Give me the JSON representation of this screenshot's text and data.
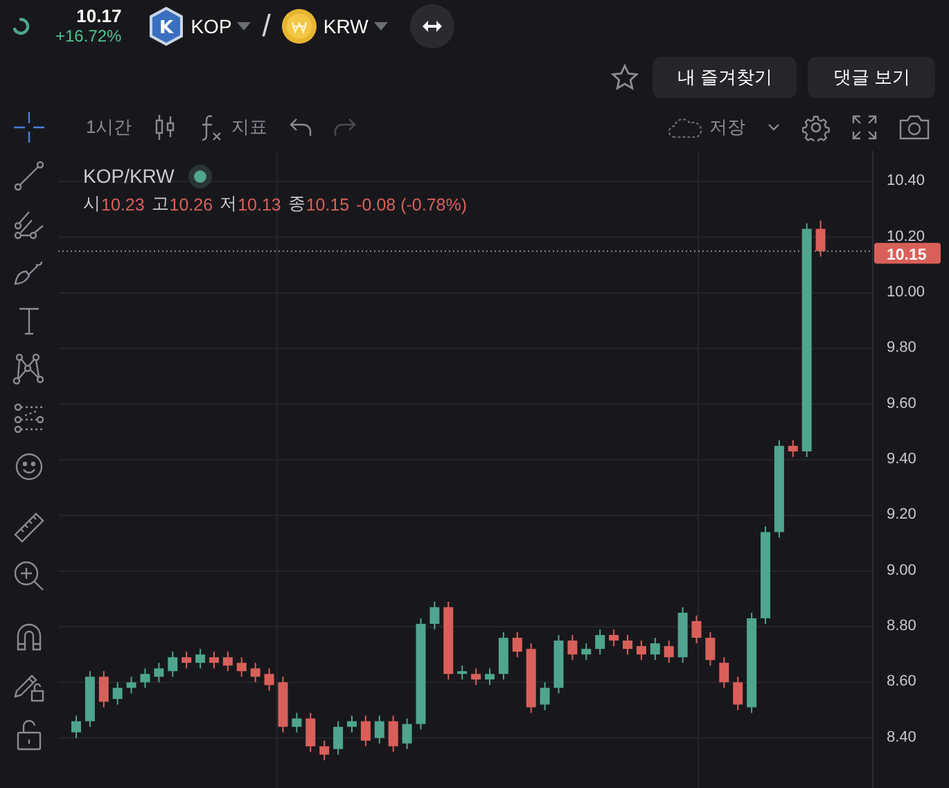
{
  "ticker": {
    "price": "10.17",
    "change": "+16.72%"
  },
  "pair": {
    "base": "KOP",
    "base_logo": "K",
    "separator": "/",
    "quote": "KRW"
  },
  "header_buttons": [
    {
      "label": "내 즐겨찾기"
    },
    {
      "label": "댓글 보기"
    }
  ],
  "chart_toolbar": {
    "interval": "1시간",
    "indicators": "지표",
    "save": "저장"
  },
  "tools": [
    {
      "kind": "crosshair",
      "selected": true
    },
    {
      "kind": "trendline",
      "selected": false
    },
    {
      "kind": "pitchfork",
      "selected": false
    },
    {
      "kind": "brush",
      "selected": false
    },
    {
      "kind": "text",
      "selected": false
    },
    {
      "kind": "pattern",
      "selected": false
    },
    {
      "kind": "prediction",
      "selected": false
    },
    {
      "kind": "emoji",
      "selected": false
    },
    {
      "kind": "ruler",
      "selected": false
    },
    {
      "kind": "zoom",
      "selected": false
    },
    {
      "kind": "magnet",
      "selected": false
    },
    {
      "kind": "lockdraw",
      "selected": false
    },
    {
      "kind": "lock",
      "selected": false
    }
  ],
  "legend": {
    "symbol": "KOP/KRW",
    "ohlc": [
      {
        "label": "시",
        "value": "10.23"
      },
      {
        "label": "고",
        "value": "10.26"
      },
      {
        "label": "저",
        "value": "10.13"
      },
      {
        "label": "종",
        "value": "10.15"
      }
    ],
    "change": "-0.08 (-0.78%)"
  },
  "chart": {
    "chart_data": {
      "type": "candlestick",
      "grid": true,
      "ylim": [
        8.22,
        10.51
      ],
      "ref_lines": [
        {
          "axis": "y",
          "value": 10.15
        }
      ],
      "ohlc": [
        [
          8.42,
          8.48,
          8.4,
          8.46
        ],
        [
          8.46,
          8.64,
          8.44,
          8.62
        ],
        [
          8.62,
          8.64,
          8.51,
          8.53
        ],
        [
          8.54,
          8.6,
          8.52,
          8.58
        ],
        [
          8.58,
          8.62,
          8.56,
          8.6
        ],
        [
          8.6,
          8.65,
          8.58,
          8.63
        ],
        [
          8.62,
          8.67,
          8.6,
          8.65
        ],
        [
          8.64,
          8.71,
          8.62,
          8.69
        ],
        [
          8.69,
          8.71,
          8.65,
          8.67
        ],
        [
          8.67,
          8.72,
          8.65,
          8.7
        ],
        [
          8.69,
          8.71,
          8.65,
          8.67
        ],
        [
          8.69,
          8.71,
          8.64,
          8.66
        ],
        [
          8.67,
          8.69,
          8.62,
          8.64
        ],
        [
          8.65,
          8.67,
          8.6,
          8.62
        ],
        [
          8.63,
          8.65,
          8.57,
          8.59
        ],
        [
          8.6,
          8.62,
          8.42,
          8.44
        ],
        [
          8.44,
          8.49,
          8.42,
          8.47
        ],
        [
          8.47,
          8.49,
          8.35,
          8.37
        ],
        [
          8.37,
          8.39,
          8.32,
          8.34
        ],
        [
          8.36,
          8.46,
          8.34,
          8.44
        ],
        [
          8.44,
          8.48,
          8.42,
          8.46
        ],
        [
          8.46,
          8.48,
          8.37,
          8.39
        ],
        [
          8.4,
          8.48,
          8.38,
          8.46
        ],
        [
          8.46,
          8.48,
          8.35,
          8.37
        ],
        [
          8.38,
          8.47,
          8.36,
          8.45
        ],
        [
          8.45,
          8.83,
          8.43,
          8.81
        ],
        [
          8.81,
          8.89,
          8.79,
          8.87
        ],
        [
          8.87,
          8.89,
          8.61,
          8.63
        ],
        [
          8.63,
          8.66,
          8.61,
          8.64
        ],
        [
          8.63,
          8.65,
          8.59,
          8.61
        ],
        [
          8.61,
          8.65,
          8.59,
          8.63
        ],
        [
          8.63,
          8.78,
          8.61,
          8.76
        ],
        [
          8.76,
          8.78,
          8.69,
          8.71
        ],
        [
          8.72,
          8.74,
          8.49,
          8.51
        ],
        [
          8.52,
          8.6,
          8.5,
          8.58
        ],
        [
          8.58,
          8.77,
          8.56,
          8.75
        ],
        [
          8.75,
          8.77,
          8.68,
          8.7
        ],
        [
          8.7,
          8.74,
          8.68,
          8.72
        ],
        [
          8.72,
          8.79,
          8.7,
          8.77
        ],
        [
          8.77,
          8.79,
          8.73,
          8.75
        ],
        [
          8.75,
          8.77,
          8.7,
          8.72
        ],
        [
          8.73,
          8.75,
          8.68,
          8.7
        ],
        [
          8.7,
          8.76,
          8.68,
          8.74
        ],
        [
          8.73,
          8.75,
          8.67,
          8.69
        ],
        [
          8.69,
          8.87,
          8.67,
          8.85
        ],
        [
          8.82,
          8.84,
          8.74,
          8.76
        ],
        [
          8.76,
          8.78,
          8.66,
          8.68
        ],
        [
          8.67,
          8.69,
          8.58,
          8.6
        ],
        [
          8.6,
          8.62,
          8.5,
          8.52
        ],
        [
          8.51,
          8.85,
          8.49,
          8.83
        ],
        [
          8.83,
          9.16,
          8.81,
          9.14
        ],
        [
          9.14,
          9.47,
          9.12,
          9.45
        ],
        [
          9.45,
          9.47,
          9.41,
          9.43
        ],
        [
          9.43,
          10.25,
          9.41,
          10.23
        ],
        [
          10.23,
          10.26,
          10.13,
          10.15
        ]
      ],
      "yticks": [
        {
          "value": 10.4,
          "label": "10.40"
        },
        {
          "value": 10.2,
          "label": "10.20"
        },
        {
          "value": 10.0,
          "label": "10.00"
        },
        {
          "value": 9.8,
          "label": "9.80"
        },
        {
          "value": 9.6,
          "label": "9.60"
        },
        {
          "value": 9.4,
          "label": "9.40"
        },
        {
          "value": 9.2,
          "label": "9.20"
        },
        {
          "value": 9.0,
          "label": "9.00"
        },
        {
          "value": 8.8,
          "label": "8.80"
        },
        {
          "value": 8.6,
          "label": "8.60"
        },
        {
          "value": 8.4,
          "label": "8.40"
        }
      ]
    },
    "last_price": "10.15"
  }
}
